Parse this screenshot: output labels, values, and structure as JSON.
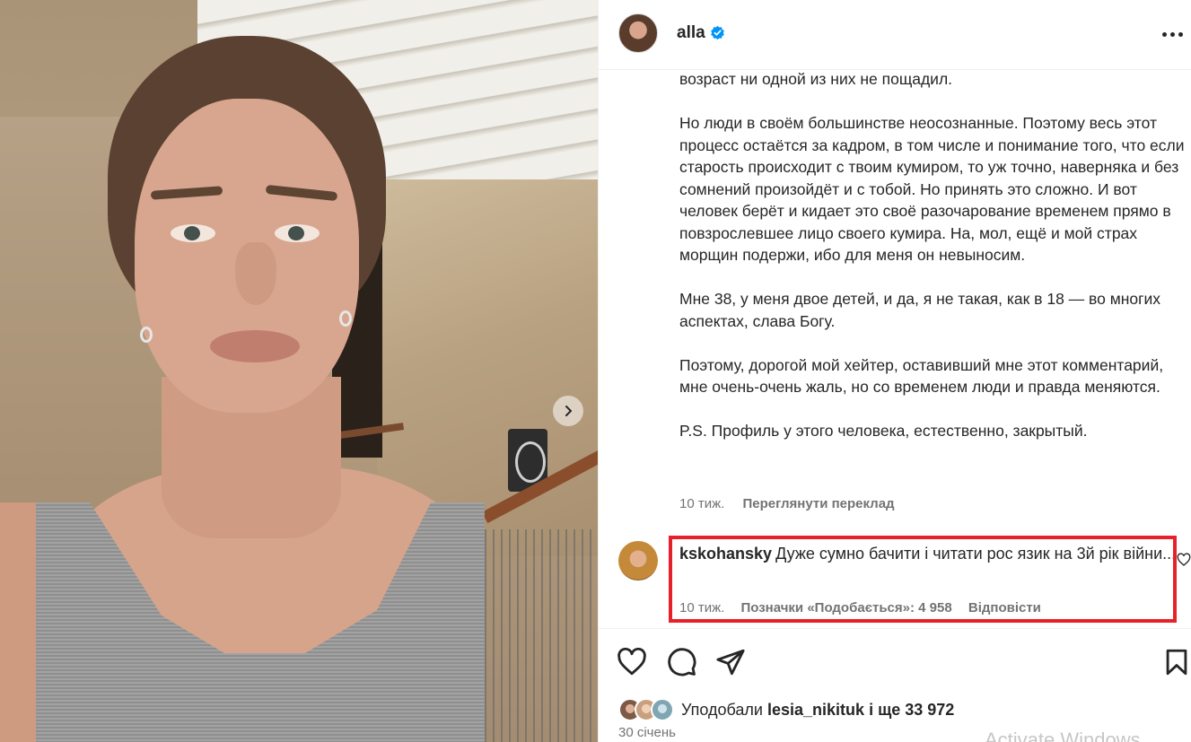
{
  "post": {
    "author": {
      "username": "alla",
      "verified": true
    },
    "caption": {
      "paragraphs": [
        "возраст ни одной из них не пощадил.",
        "Но люди в своём большинстве неосознанные. Поэтому весь этот процесс остаётся за кадром, в том числе и понимание того, что если старость происходит с твоим кумиром, то уж точно, наверняка и без сомнений произойдёт и с тобой. Но принять это сложно. И вот человек берёт и кидает это своё разочарование временем прямо в повзрослевшее лицо своего кумира. На, мол, ещё и мой страх морщин подержи, ибо для меня он невыносим.",
        "Мне 38, у меня двое детей, и да, я не такая, как в 18 — во многих аспектах, слава Богу.",
        "Поэтому, дорогой мой хейтер, оставивший мне этот комментарий, мне очень-очень жаль, но со временем люди и правда меняются.",
        "P.S. Профиль у этого человека, естественно, закрытый."
      ]
    },
    "meta": {
      "time": "10 тиж.",
      "translate_label": "Переглянути переклад"
    },
    "comment": {
      "username": "kskohansky",
      "text": "Дуже сумно бачити і читати рос язик на 3й рік війни...",
      "time": "10 тиж.",
      "likes_label": "Позначки «Подобається»: 4 958",
      "reply_label": "Відповісти"
    },
    "likes": {
      "prefix": "Уподобали",
      "user": "lesia_nikituk",
      "suffix": "і ще 33 972"
    },
    "date": "30 січень",
    "watermark": "Activate Windows"
  },
  "icons": {
    "next": "chevron-right-icon",
    "more": "more-options-icon",
    "verified": "verified-badge-icon",
    "like": "heart-icon",
    "comment": "comment-icon",
    "share": "share-icon",
    "save": "bookmark-icon"
  },
  "colors": {
    "highlight": "#e8202a",
    "verified": "#0095f6",
    "text": "#262626",
    "secondary": "#737373"
  }
}
